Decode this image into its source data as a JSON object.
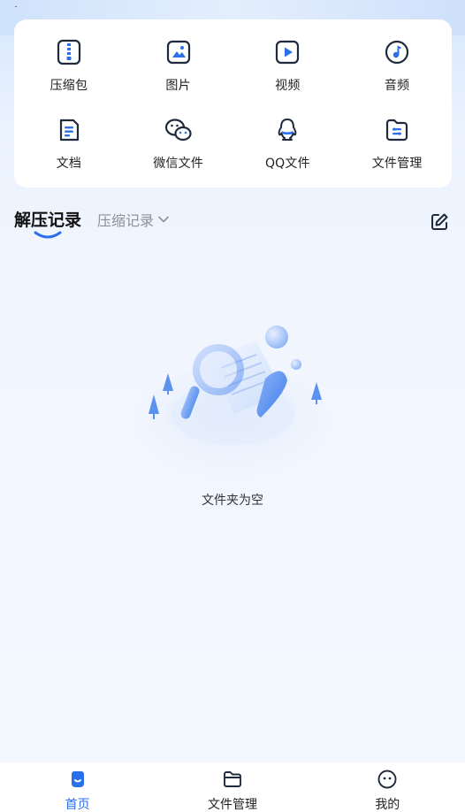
{
  "status_bar": {},
  "tools": [
    {
      "label": "压缩包",
      "icon": "zip-archive-icon"
    },
    {
      "label": "图片",
      "icon": "image-icon"
    },
    {
      "label": "视频",
      "icon": "video-play-icon"
    },
    {
      "label": "音频",
      "icon": "music-note-icon"
    },
    {
      "label": "文档",
      "icon": "document-icon"
    },
    {
      "label": "微信文件",
      "icon": "wechat-icon"
    },
    {
      "label": "QQ文件",
      "icon": "qq-penguin-icon"
    },
    {
      "label": "文件管理",
      "icon": "folder-manage-icon"
    }
  ],
  "records": {
    "active_tab": "解压记录",
    "other_tab": "压缩记录",
    "edit_icon": "edit-icon"
  },
  "empty_state": {
    "text": "文件夹为空",
    "illustration": "magnifier-document-illustration"
  },
  "bottom_nav": [
    {
      "label": "首页",
      "icon": "home-icon",
      "active": true
    },
    {
      "label": "文件管理",
      "icon": "folder-icon",
      "active": false
    },
    {
      "label": "我的",
      "icon": "profile-face-icon",
      "active": false
    }
  ],
  "colors": {
    "accent": "#2b6fe9",
    "icon_dark": "#1f2a3d",
    "inactive_tab": "#8d9096"
  }
}
